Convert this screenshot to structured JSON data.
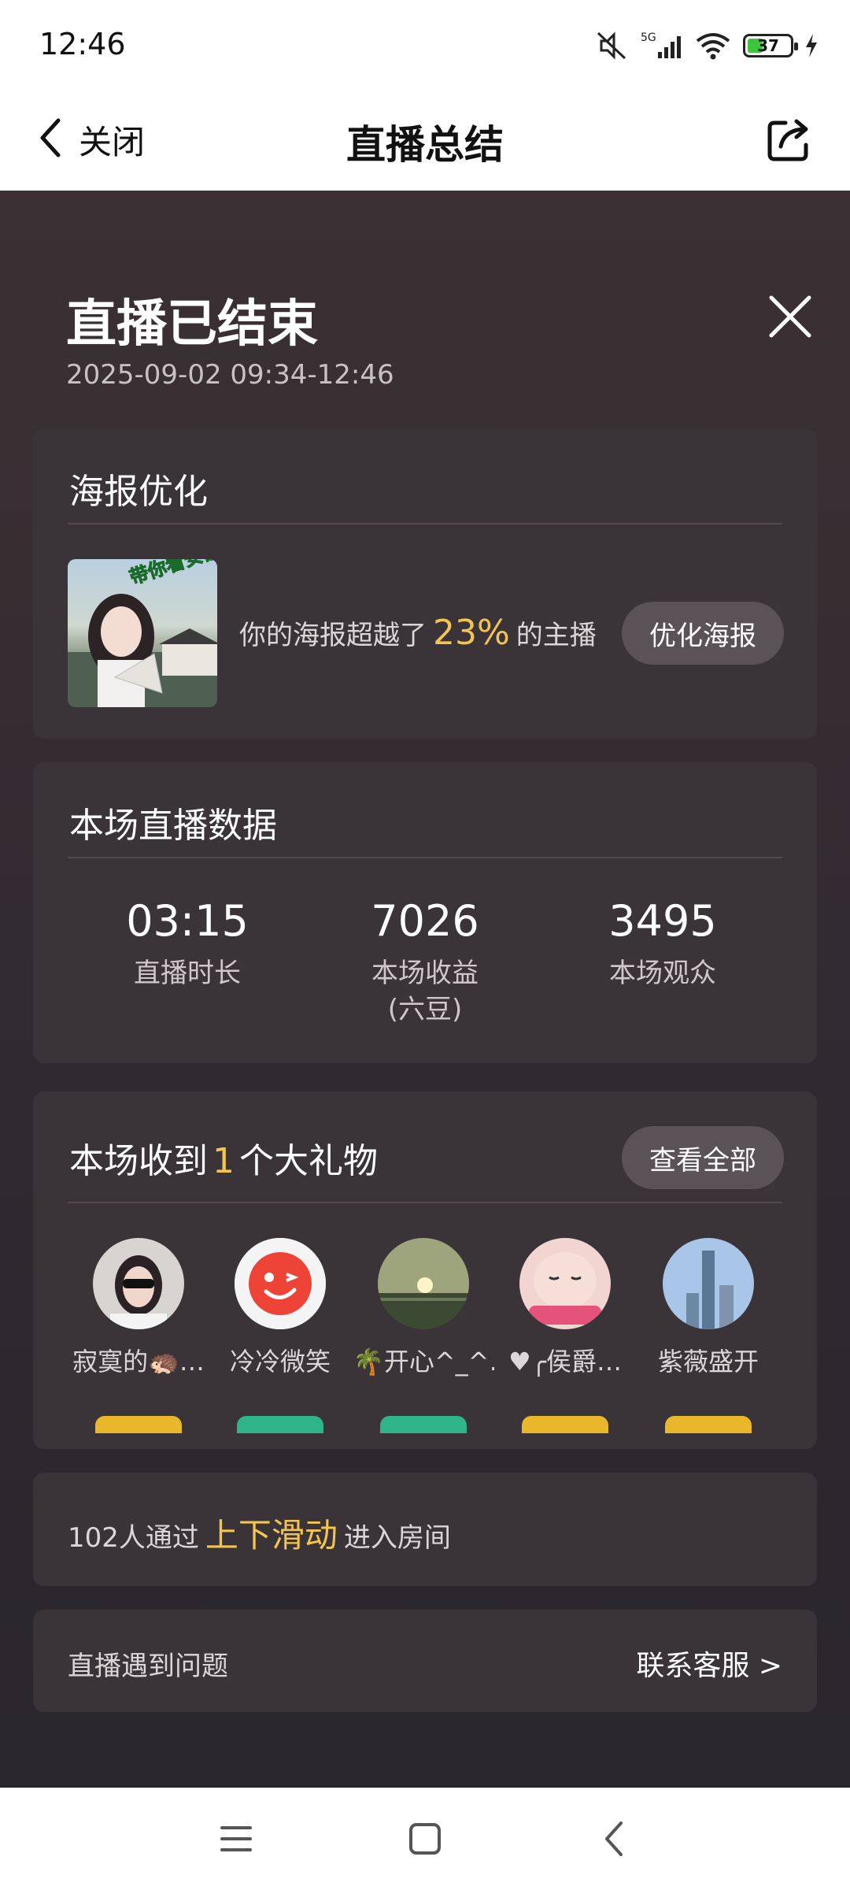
{
  "status_bar": {
    "time": "12:46",
    "network": "5G",
    "battery": "37",
    "battery_level": 0.37,
    "icons": [
      "mute-icon",
      "signal-icon",
      "wifi-icon",
      "battery-icon",
      "charging-icon"
    ]
  },
  "header": {
    "back_label": "关闭",
    "title": "直播总结",
    "icons": [
      "chevron-left-icon",
      "share-icon"
    ]
  },
  "summary": {
    "title": "直播已结束",
    "time_range": "2025-09-02 09:34-12:46"
  },
  "poster": {
    "section_title": "海报优化",
    "thumbnail_caption": "带你看安徽",
    "text_before": "你的海报超越了",
    "percent": "23%",
    "text_after": "的主播",
    "button": "优化海报"
  },
  "live_data": {
    "section_title": "本场直播数据",
    "stats": [
      {
        "value": "03:15",
        "label": "直播时长"
      },
      {
        "value": "7026",
        "label": "本场收益",
        "sublabel": "(六豆)"
      },
      {
        "value": "3495",
        "label": "本场观众"
      }
    ]
  },
  "gifts": {
    "title_before": "本场收到",
    "count": "1",
    "title_after": "个大礼物",
    "button": "查看全部",
    "gifters": [
      {
        "name": "寂寞的🦔…",
        "badge_color": "#e8b82a"
      },
      {
        "name": "冷冷微笑",
        "badge_color": "#2fb389"
      },
      {
        "name": "🌴开心^_^…",
        "badge_color": "#2fb389"
      },
      {
        "name": "♥╭侯爵…",
        "badge_color": "#e8b82a"
      },
      {
        "name": "紫薇盛开",
        "badge_color": "#e8b82a"
      }
    ]
  },
  "swipe": {
    "text_before": "102人通过",
    "highlight": "上下滑动",
    "text_after": "进入房间"
  },
  "help": {
    "text": "直播遇到问题",
    "link": "联系客服 >"
  },
  "colors": {
    "accent": "#f3c44f",
    "card_bg": "#3a3438",
    "button_bg": "#5b5258"
  }
}
